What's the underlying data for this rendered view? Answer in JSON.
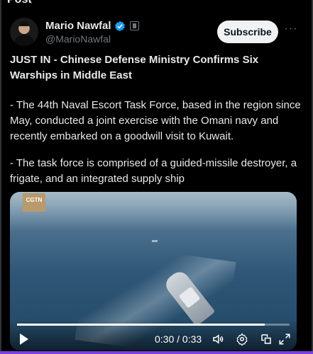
{
  "top_cut_text": "Post",
  "author": {
    "display_name": "Mario Nawfal",
    "handle": "@MarioNawfal",
    "verified": true
  },
  "actions": {
    "subscribe_label": "Subscribe",
    "more_label": "···"
  },
  "post": {
    "headline": "JUST IN - Chinese Defense Ministry Confirms Six Warships in Middle East",
    "paragraph1": "- The 44th Naval Escort Task Force, based in the region since May, conducted a joint exercise with the Omani navy and recently embarked on a goodwill visit to Kuwait.",
    "paragraph2": "- The task force is comprised of a guided-missile destroyer, a frigate, and an integrated supply ship"
  },
  "video": {
    "watermark": "CGTN",
    "time_display": "0:30 / 0:33",
    "progress_fraction": 0.91,
    "icons": [
      "play-icon",
      "volume-icon",
      "settings-icon",
      "picture-in-picture-icon",
      "fullscreen-icon"
    ]
  },
  "colors": {
    "accent": "#1d9bf0",
    "background": "#000000",
    "text": "#e7e9ea",
    "muted": "#71767b"
  }
}
